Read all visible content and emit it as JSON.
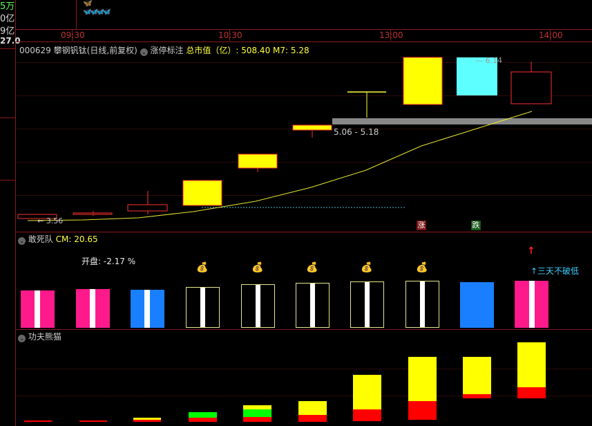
{
  "left_axis": {
    "labels": [
      "5万",
      "0亿",
      "9亿",
      "27.0"
    ]
  },
  "top_strip": {
    "butterflies_gold": "🦋",
    "butterflies_cyan": "🦋🦋🦋🦋"
  },
  "time_axis": {
    "labels": [
      "09:30",
      "10:30",
      "13:00",
      "14:00"
    ]
  },
  "main_panel": {
    "stock_code": "000629",
    "stock_name": "攀钢钒钛",
    "period_info": "(日线,前复权)",
    "indicator_name": "涨停标注",
    "metric_label": "总市值（亿）",
    "metric_value": ": 508.40",
    "ma_label": "M7: 5.28",
    "gap_label": "5.06 - 5.18",
    "low_label": "← 3.56",
    "high_label": "6.14",
    "high_label_prefix": "—",
    "tag_up": "涨",
    "tag_down": "跌",
    "colors": {
      "candle_border": "#ff3030",
      "candle_fill": "#ffff00",
      "cyan_candle": "#5effff",
      "ma_line": "#e8e830",
      "gap_zone": "#888888",
      "support_line": "#3fc0d0"
    }
  },
  "panel2": {
    "title": "敢死队",
    "cm_label": "CM: 20.65",
    "open_label": "开盘: -2.17 %",
    "signal_text": "↑三天不破低",
    "bag_icon": "💰",
    "arrow_icon": "↑",
    "colors": {
      "pink": "#ff1a8c",
      "blue": "#1a7fff",
      "black_box_border": "#e8e890"
    }
  },
  "panel3": {
    "title": "功夫熊猫",
    "colors": {
      "yellow": "#ffff00",
      "red": "#ff0000",
      "green": "#00ff00"
    }
  }
}
